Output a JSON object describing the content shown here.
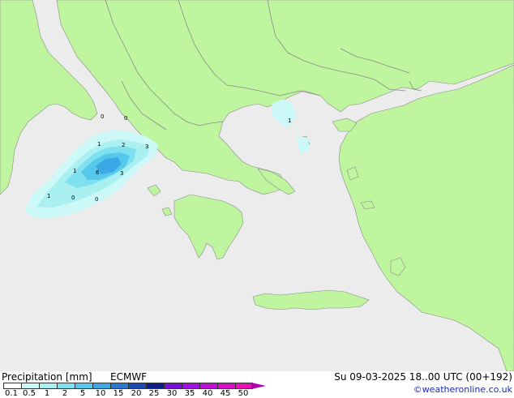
{
  "header": {
    "title": "Precipitation [mm]",
    "model": "ECMWF",
    "datetime": "Su 09-03-2025 18..00 UTC (00+192)",
    "credit": "©weatheronline.co.uk"
  },
  "colors": {
    "sea": "#ececec",
    "land": "#bff59f",
    "border": "#8a8a8a"
  },
  "legend": {
    "ticks": [
      "0.1",
      "0.5",
      "1",
      "2",
      "5",
      "10",
      "15",
      "20",
      "25",
      "30",
      "35",
      "40",
      "45",
      "50"
    ],
    "colors": [
      "#ffffff",
      "#cdf8f8",
      "#aaf0f0",
      "#7fe0f0",
      "#55c8ec",
      "#3aa8e4",
      "#2a78d0",
      "#1a48b4",
      "#0a1e8c",
      "#7a10d8",
      "#a010e0",
      "#c010d8",
      "#d810c8",
      "#e810b8"
    ]
  },
  "rain_labels": [
    "0",
    "0",
    "1",
    "2",
    "3",
    "1",
    "6",
    "3",
    "1",
    "0",
    "0",
    "1"
  ]
}
